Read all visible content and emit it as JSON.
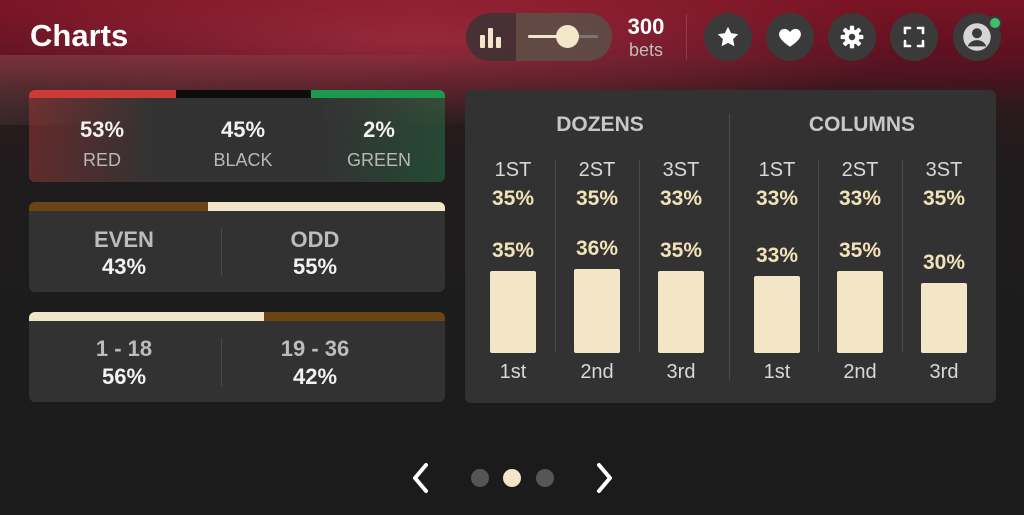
{
  "header": {
    "title": "Charts",
    "bets": {
      "count": "300",
      "label": "bets",
      "slider_level": 0.45
    },
    "icons": [
      "bar-chart-icon",
      "star-icon",
      "heart-icon",
      "gear-icon",
      "fullscreen-icon",
      "user-icon"
    ],
    "online_status_color": "#3fbf6a"
  },
  "colors": {
    "red": "#cc3a3a",
    "black": "#0c0c0c",
    "green": "#1a9a4f",
    "accent": "#f1e6c8",
    "even_odd_dark": "#6a4413"
  },
  "red_black_green": {
    "red": {
      "pct": "53%",
      "label": "RED"
    },
    "black": {
      "pct": "45%",
      "label": "BLACK"
    },
    "green": {
      "pct": "2%",
      "label": "GREEN"
    }
  },
  "even_odd": {
    "even": {
      "label": "EVEN",
      "pct": "43%"
    },
    "odd": {
      "label": "ODD",
      "pct": "55%"
    }
  },
  "low_high": {
    "low": {
      "label": "1 - 18",
      "pct": "56%"
    },
    "high": {
      "label": "19 - 36",
      "pct": "42%"
    }
  },
  "dozens": {
    "title": "DOZENS",
    "cols": [
      {
        "head": "1ST",
        "pct": "35%",
        "bar_pct": "35%",
        "bar_value": 35,
        "label": "1st"
      },
      {
        "head": "2ST",
        "pct": "35%",
        "bar_pct": "36%",
        "bar_value": 36,
        "label": "2nd"
      },
      {
        "head": "3ST",
        "pct": "33%",
        "bar_pct": "35%",
        "bar_value": 35,
        "label": "3rd"
      }
    ]
  },
  "columns": {
    "title": "COLUMNS",
    "cols": [
      {
        "head": "1ST",
        "pct": "33%",
        "bar_pct": "33%",
        "bar_value": 33,
        "label": "1st"
      },
      {
        "head": "2ST",
        "pct": "33%",
        "bar_pct": "35%",
        "bar_value": 35,
        "label": "2nd"
      },
      {
        "head": "3ST",
        "pct": "35%",
        "bar_pct": "30%",
        "bar_value": 30,
        "label": "3rd"
      }
    ]
  },
  "pagination": {
    "total": 3,
    "active": 2
  }
}
